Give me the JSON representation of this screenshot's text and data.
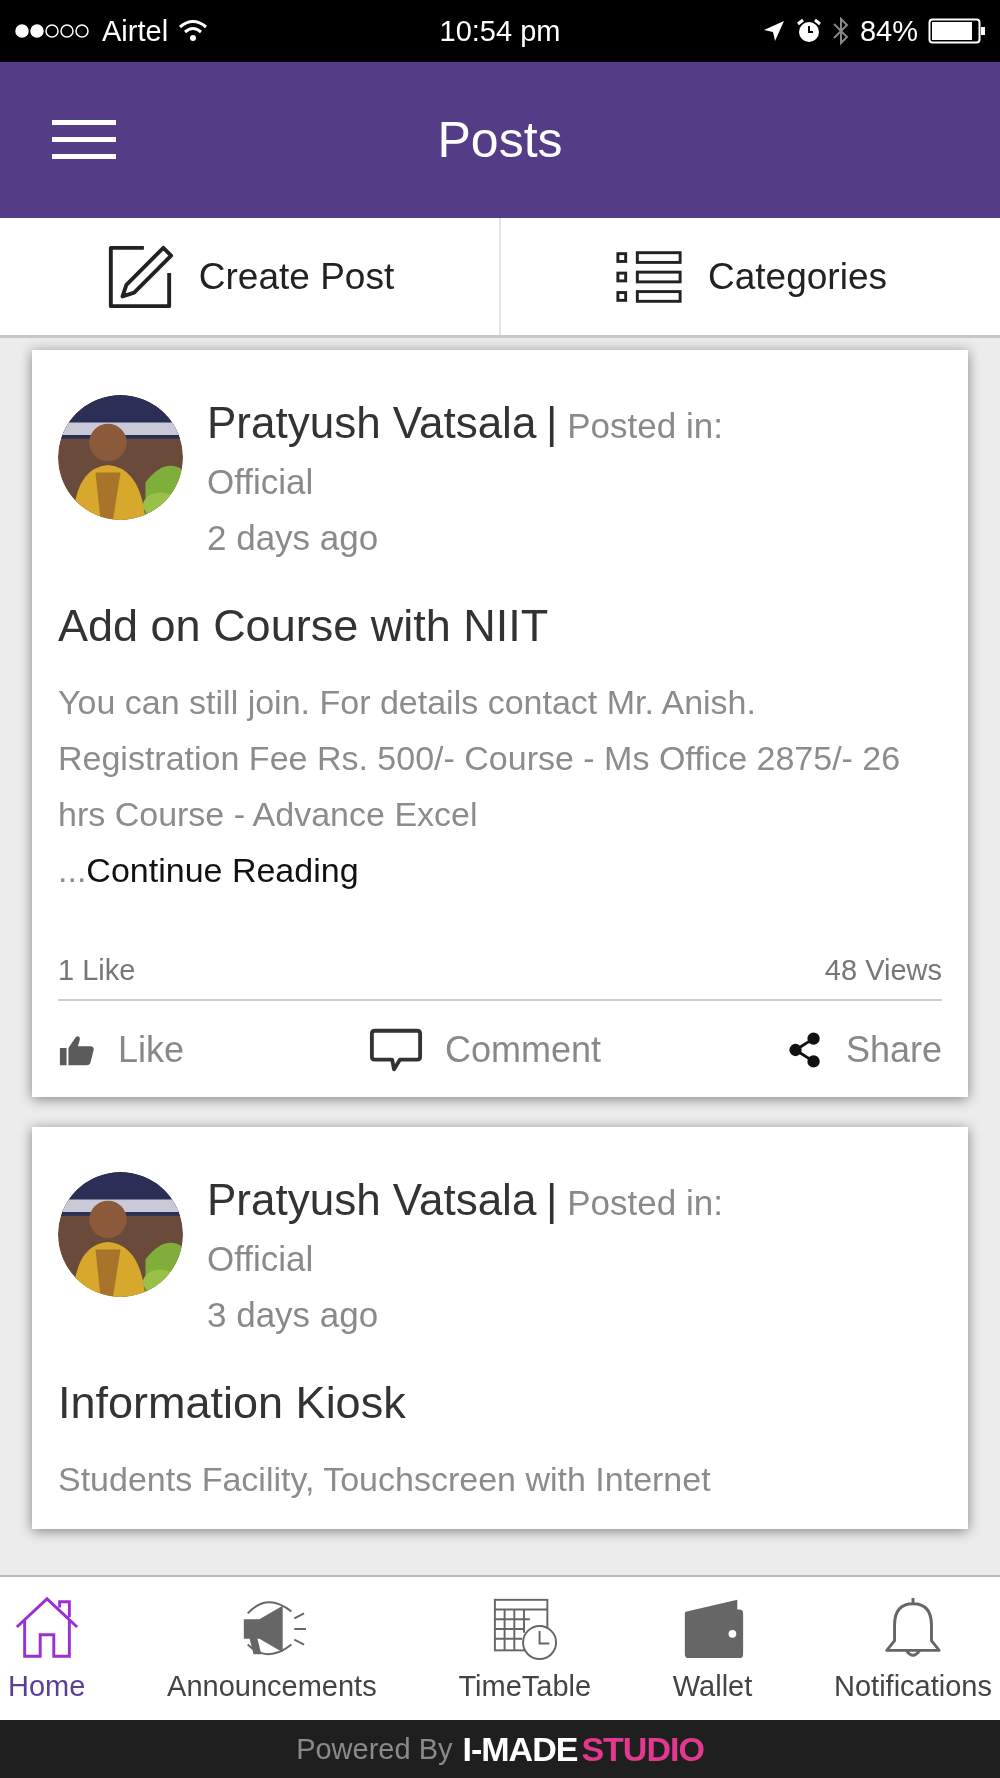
{
  "status_bar": {
    "carrier": "Airtel",
    "time": "10:54 pm",
    "battery": "84%"
  },
  "header": {
    "title": "Posts"
  },
  "toolbar": [
    {
      "kind": "create",
      "label": "Create Post"
    },
    {
      "kind": "categories",
      "label": "Categories"
    }
  ],
  "posts": [
    {
      "author": "Pratyush Vatsala",
      "separator": "|",
      "posted_in_label": "Posted in:",
      "category": "Official",
      "time": "2 days ago",
      "title": "Add on Course with NIIT",
      "body": "You can still join. For details contact Mr. Anish. Registration Fee Rs. 500/- Course - Ms Office 2875/- 26 hrs Course - Advance Excel",
      "ellipsis": "...",
      "continue": "Continue Reading",
      "likes": "1 Like",
      "views": "48 Views",
      "actions": [
        {
          "kind": "like",
          "label": "Like"
        },
        {
          "kind": "comment",
          "label": "Comment"
        },
        {
          "kind": "share",
          "label": "Share"
        }
      ]
    },
    {
      "author": "Pratyush Vatsala",
      "separator": "|",
      "posted_in_label": "Posted in:",
      "category": "Official",
      "time": "3 days ago",
      "title": "Information Kiosk",
      "body": "Students Facility, Touchscreen with Internet"
    }
  ],
  "bottom_nav": [
    {
      "kind": "home",
      "label": "Home",
      "selected": true
    },
    {
      "kind": "announcements",
      "label": "Announcements",
      "selected": false
    },
    {
      "kind": "timetable",
      "label": "TimeTable",
      "selected": false
    },
    {
      "kind": "wallet",
      "label": "Wallet",
      "selected": false
    },
    {
      "kind": "notifications",
      "label": "Notifications",
      "selected": false
    }
  ],
  "footer": {
    "prefix": "Powered By",
    "brand_first": "I-MADE",
    "brand_second": "STUDIO"
  }
}
